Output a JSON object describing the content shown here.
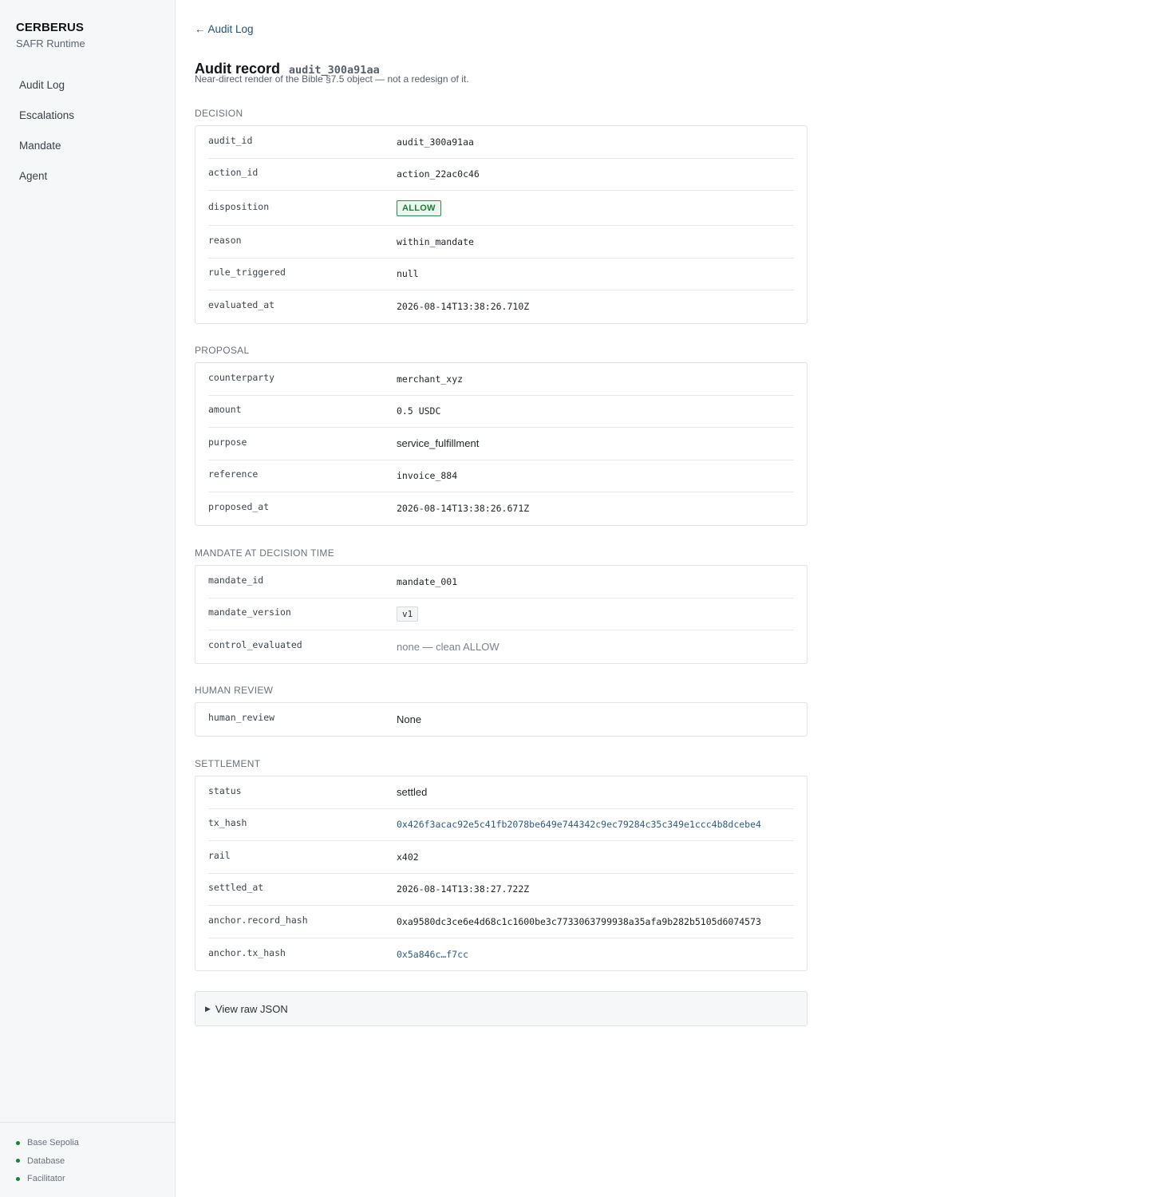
{
  "sidebar": {
    "brand": "CERBERUS",
    "subtitle": "SAFR Runtime",
    "nav": [
      "Audit Log",
      "Escalations",
      "Mandate",
      "Agent"
    ],
    "status": [
      {
        "label": "Base Sepolia",
        "state": "ok"
      },
      {
        "label": "Database",
        "state": "ok"
      },
      {
        "label": "Facilitator",
        "state": "ok"
      }
    ],
    "status_color": "#1a7f37"
  },
  "header": {
    "back_arrow": "←",
    "back_label": "Audit Log",
    "title": "Audit record",
    "record_id": "audit_300a91aa",
    "description": "Near-direct render of the Bible §7.5 object — not a redesign of it."
  },
  "decision": {
    "label": "DECISION",
    "rows": [
      {
        "key": "audit_id",
        "value": "audit_300a91aa"
      },
      {
        "key": "action_id",
        "value": "action_22ac0c46"
      },
      {
        "key": "disposition",
        "value": "ALLOW"
      },
      {
        "key": "reason",
        "value": "within_mandate"
      },
      {
        "key": "rule_triggered",
        "value": "null"
      },
      {
        "key": "evaluated_at",
        "value": "2026-08-14T13:38:26.710Z"
      }
    ]
  },
  "proposal": {
    "label": "PROPOSAL",
    "rows": [
      {
        "key": "counterparty",
        "value": "merchant_xyz"
      },
      {
        "key": "amount",
        "value": "0.5 USDC"
      },
      {
        "key": "purpose",
        "value": "service_fulfillment"
      },
      {
        "key": "reference",
        "value": "invoice_884"
      },
      {
        "key": "proposed_at",
        "value": "2026-08-14T13:38:26.671Z"
      }
    ]
  },
  "mandate": {
    "label": "MANDATE AT DECISION TIME",
    "rows": [
      {
        "key": "mandate_id",
        "value": "mandate_001"
      },
      {
        "key": "mandate_version",
        "value": "v1"
      },
      {
        "key": "control_evaluated",
        "value": "none — clean ALLOW"
      }
    ]
  },
  "human_review": {
    "label": "HUMAN REVIEW",
    "rows": [
      {
        "key": "human_review",
        "value": "None"
      }
    ]
  },
  "settlement": {
    "label": "SETTLEMENT",
    "rows": [
      {
        "key": "status",
        "value": "settled"
      },
      {
        "key": "tx_hash",
        "value": "0x426f3acac92e5c41fb2078be649e744342c9ec79284c35c349e1ccc4b8dcebe4"
      },
      {
        "key": "rail",
        "value": "x402"
      },
      {
        "key": "settled_at",
        "value": "2026-08-14T13:38:27.722Z"
      },
      {
        "key": "anchor.record_hash",
        "value": "0xa9580dc3ce6e4d68c1c1600be3c7733063799938a35afa9b282b5105d6074573"
      },
      {
        "key": "anchor.tx_hash",
        "value": "0x5a846c…f7cc"
      }
    ]
  },
  "raw_json": {
    "arrow": "▶",
    "label": "View raw JSON"
  },
  "colors": {
    "accent_link": "#24507a",
    "allow_green": "#1a7f37",
    "border": "#dfe2e6"
  }
}
